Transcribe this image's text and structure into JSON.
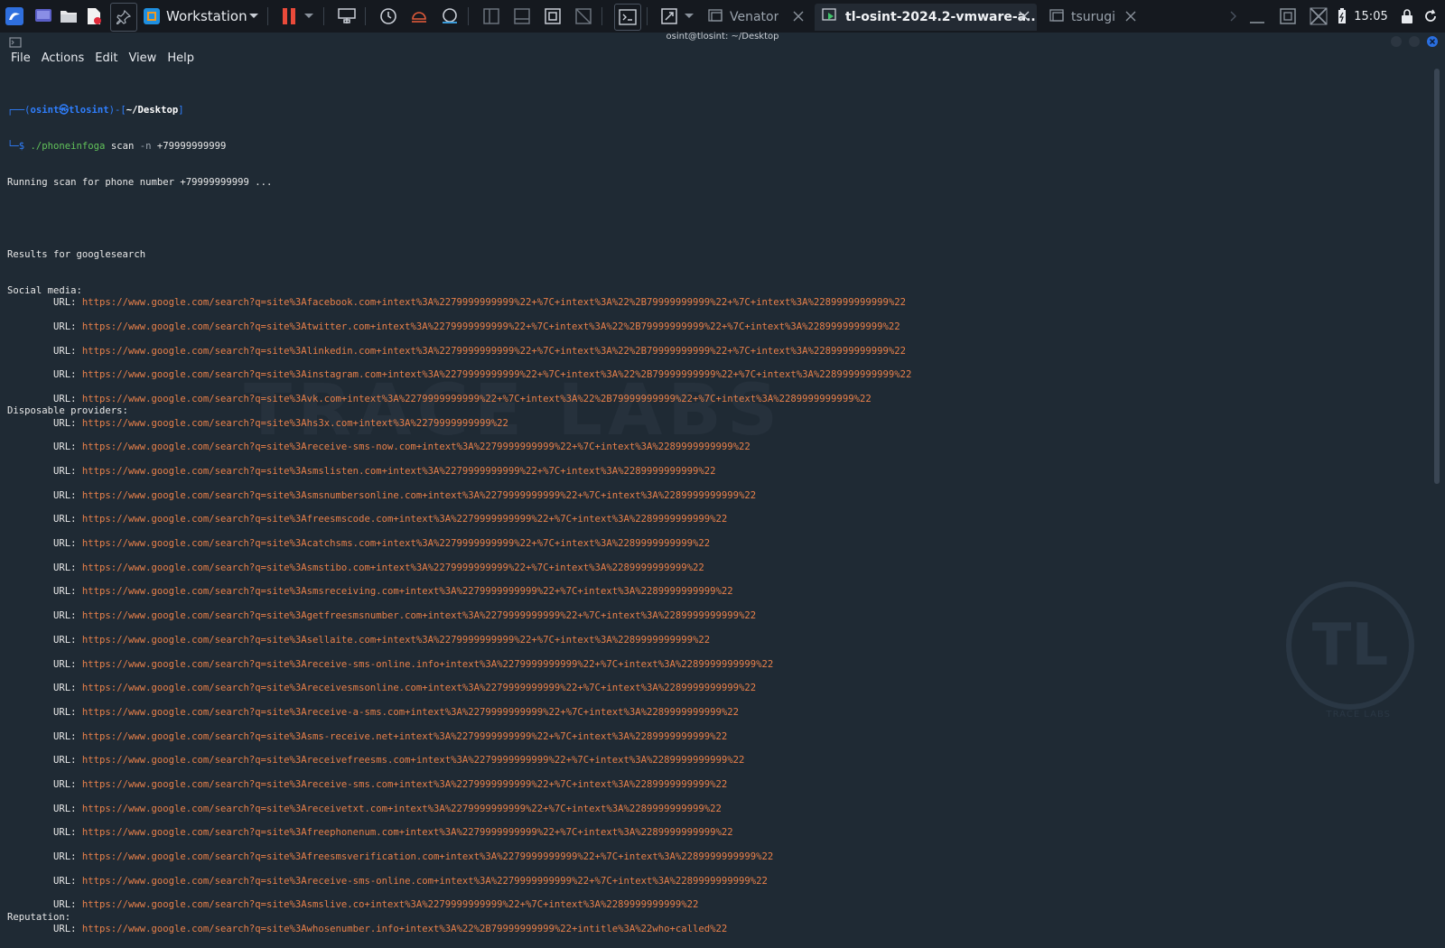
{
  "topbar": {
    "app_label": "Workstation",
    "tabs": [
      {
        "label": "Venator",
        "active": false
      },
      {
        "label": "tl-osint-2024.2-vmware-a...",
        "active": true
      },
      {
        "label": "tsurugi",
        "active": false
      }
    ],
    "clock": "15:05"
  },
  "window": {
    "title": "osint@tlosint: ~/Desktop"
  },
  "menu": [
    "File",
    "Actions",
    "Edit",
    "View",
    "Help"
  ],
  "terminal": {
    "prompt": {
      "open": "┌──(",
      "user": "osint㉿tlosint",
      "mid": ")-[",
      "dir": "~/Desktop",
      "close": "]",
      "arrow": "└─$ "
    },
    "command_bin": "./phoneinfoga",
    "command_rest": " scan ",
    "command_flag": "-n",
    "command_arg": " +79999999999",
    "running": "Running scan for phone number +79999999999 ...",
    "results_header": "Results for googlesearch",
    "url_prefix": "URL: ",
    "sections": [
      {
        "title": "Social media:",
        "urls": [
          "https://www.google.com/search?q=site%3Afacebook.com+intext%3A%2279999999999%22+%7C+intext%3A%22%2B79999999999%22+%7C+intext%3A%2289999999999%22",
          "https://www.google.com/search?q=site%3Atwitter.com+intext%3A%2279999999999%22+%7C+intext%3A%22%2B79999999999%22+%7C+intext%3A%2289999999999%22",
          "https://www.google.com/search?q=site%3Alinkedin.com+intext%3A%2279999999999%22+%7C+intext%3A%22%2B79999999999%22+%7C+intext%3A%2289999999999%22",
          "https://www.google.com/search?q=site%3Ainstagram.com+intext%3A%2279999999999%22+%7C+intext%3A%22%2B79999999999%22+%7C+intext%3A%2289999999999%22",
          "https://www.google.com/search?q=site%3Avk.com+intext%3A%2279999999999%22+%7C+intext%3A%22%2B79999999999%22+%7C+intext%3A%2289999999999%22"
        ]
      },
      {
        "title": "Disposable providers:",
        "urls": [
          "https://www.google.com/search?q=site%3Ahs3x.com+intext%3A%2279999999999%22",
          "https://www.google.com/search?q=site%3Areceive-sms-now.com+intext%3A%2279999999999%22+%7C+intext%3A%2289999999999%22",
          "https://www.google.com/search?q=site%3Asmslisten.com+intext%3A%2279999999999%22+%7C+intext%3A%2289999999999%22",
          "https://www.google.com/search?q=site%3Asmsnumbersonline.com+intext%3A%2279999999999%22+%7C+intext%3A%2289999999999%22",
          "https://www.google.com/search?q=site%3Afreesmscode.com+intext%3A%2279999999999%22+%7C+intext%3A%2289999999999%22",
          "https://www.google.com/search?q=site%3Acatchsms.com+intext%3A%2279999999999%22+%7C+intext%3A%2289999999999%22",
          "https://www.google.com/search?q=site%3Asmstibo.com+intext%3A%2279999999999%22+%7C+intext%3A%2289999999999%22",
          "https://www.google.com/search?q=site%3Asmsreceiving.com+intext%3A%2279999999999%22+%7C+intext%3A%2289999999999%22",
          "https://www.google.com/search?q=site%3Agetfreesmsnumber.com+intext%3A%2279999999999%22+%7C+intext%3A%2289999999999%22",
          "https://www.google.com/search?q=site%3Asellaite.com+intext%3A%2279999999999%22+%7C+intext%3A%2289999999999%22",
          "https://www.google.com/search?q=site%3Areceive-sms-online.info+intext%3A%2279999999999%22+%7C+intext%3A%2289999999999%22",
          "https://www.google.com/search?q=site%3Areceivesmsonline.com+intext%3A%2279999999999%22+%7C+intext%3A%2289999999999%22",
          "https://www.google.com/search?q=site%3Areceive-a-sms.com+intext%3A%2279999999999%22+%7C+intext%3A%2289999999999%22",
          "https://www.google.com/search?q=site%3Asms-receive.net+intext%3A%2279999999999%22+%7C+intext%3A%2289999999999%22",
          "https://www.google.com/search?q=site%3Areceivefreesms.com+intext%3A%2279999999999%22+%7C+intext%3A%2289999999999%22",
          "https://www.google.com/search?q=site%3Areceive-sms.com+intext%3A%2279999999999%22+%7C+intext%3A%2289999999999%22",
          "https://www.google.com/search?q=site%3Areceivetxt.com+intext%3A%2279999999999%22+%7C+intext%3A%2289999999999%22",
          "https://www.google.com/search?q=site%3Afreephonenum.com+intext%3A%2279999999999%22+%7C+intext%3A%2289999999999%22",
          "https://www.google.com/search?q=site%3Afreesmsverification.com+intext%3A%2279999999999%22+%7C+intext%3A%2289999999999%22",
          "https://www.google.com/search?q=site%3Areceive-sms-online.com+intext%3A%2279999999999%22+%7C+intext%3A%2289999999999%22",
          "https://www.google.com/search?q=site%3Asmslive.co+intext%3A%2279999999999%22+%7C+intext%3A%2289999999999%22"
        ]
      },
      {
        "title": "Reputation:",
        "urls": [
          "https://www.google.com/search?q=site%3Awhosenumber.info+intext%3A%22%2B79999999999%22+intitle%3A%22who+called%22"
        ]
      }
    ]
  },
  "background": {
    "watermark": "TRACE LABS",
    "logo_letters": "TL",
    "logo_caption": "TRACE LABS"
  },
  "colors": {
    "terminal_bg": "#1f2a34",
    "url": "#e8804a",
    "prompt_blue": "#2f7fff",
    "command_green": "#62c35a",
    "topbar_bg": "#15191f"
  }
}
